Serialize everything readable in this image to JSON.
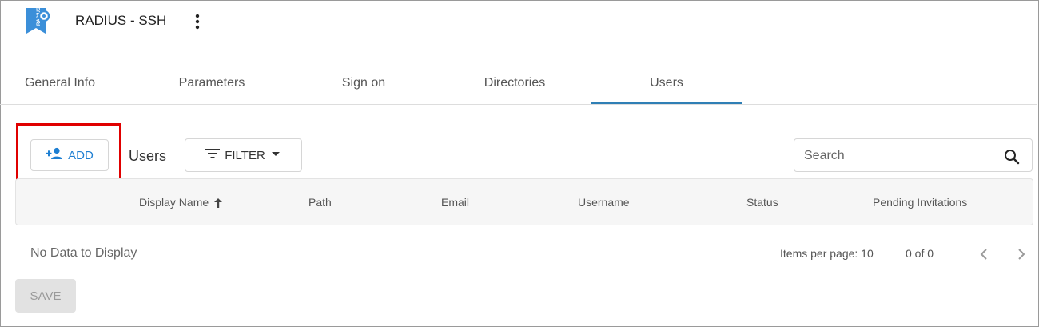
{
  "app": {
    "title": "RADIUS - SSH",
    "logo_text": "RADIUS"
  },
  "tabs": [
    {
      "label": "General Info",
      "active": false
    },
    {
      "label": "Parameters",
      "active": false
    },
    {
      "label": "Sign on",
      "active": false
    },
    {
      "label": "Directories",
      "active": false
    },
    {
      "label": "Users",
      "active": true
    }
  ],
  "toolbar": {
    "add_label": "ADD",
    "users_label": "Users",
    "filter_label": "FILTER",
    "search_placeholder": "Search"
  },
  "table": {
    "columns": [
      "Display Name",
      "Path",
      "Email",
      "Username",
      "Status",
      "Pending Invitations"
    ],
    "sorted_column": "Display Name",
    "empty_text": "No Data to Display"
  },
  "paginator": {
    "items_per_page_label": "Items per page: 10",
    "range": "0 of 0"
  },
  "footer": {
    "save_label": "SAVE"
  },
  "colors": {
    "accent": "#1e7fd2",
    "tab_indicator": "#2f7fb5",
    "highlight": "#e00000",
    "disabled_bg": "#e2e2e2"
  }
}
